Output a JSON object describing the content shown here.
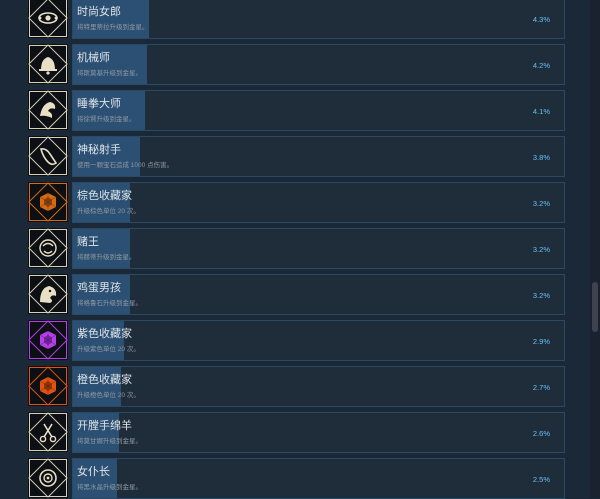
{
  "achievements": [
    {
      "title": "时尚女郎",
      "desc": "将特里蒂拉升级到金星。",
      "pct": "4.3%",
      "percent": 4.3,
      "icon": "eye-emblem-icon",
      "gem": "#d8cfb6"
    },
    {
      "title": "机械师",
      "desc": "将斯莫基升级到金星。",
      "pct": "4.2%",
      "percent": 4.2,
      "icon": "bell-icon",
      "gem": "#d8cfb6"
    },
    {
      "title": "睡拳大师",
      "desc": "将徐賢升级到金星。",
      "pct": "4.1%",
      "percent": 4.1,
      "icon": "dragon-icon",
      "gem": "#d8cfb6"
    },
    {
      "title": "神秘射手",
      "desc": "使用一颗宝石造成 1000 点伤害。",
      "pct": "3.8%",
      "percent": 3.8,
      "icon": "hand-icon",
      "gem": "#d8cfb6"
    },
    {
      "title": "棕色收藏家",
      "desc": "升级棕色单位 20 次。",
      "pct": "3.2%",
      "percent": 3.2,
      "icon": "brown-gem-icon",
      "gem": "#d96a12"
    },
    {
      "title": "赌王",
      "desc": "将赫蒂升级到金星。",
      "pct": "3.2%",
      "percent": 3.2,
      "icon": "gambler-icon",
      "gem": "#d8cfb6"
    },
    {
      "title": "鸡蛋男孩",
      "desc": "将格鲁石升级到金星。",
      "pct": "3.2%",
      "percent": 3.2,
      "icon": "beast-icon",
      "gem": "#d8cfb6"
    },
    {
      "title": "紫色收藏家",
      "desc": "升级紫色单位 20 次。",
      "pct": "2.9%",
      "percent": 2.9,
      "icon": "purple-gem-icon",
      "gem": "#b83cf0"
    },
    {
      "title": "橙色收藏家",
      "desc": "升级橙色单位 20 次。",
      "pct": "2.7%",
      "percent": 2.7,
      "icon": "orange-gem-icon",
      "gem": "#e4520e"
    },
    {
      "title": "开膛手绵羊",
      "desc": "将莫甘娜升级到金星。",
      "pct": "2.6%",
      "percent": 2.6,
      "icon": "scissors-icon",
      "gem": "#d8cfb6"
    },
    {
      "title": "女仆长",
      "desc": "将黑水晶升级到金星。",
      "pct": "2.5%",
      "percent": 2.5,
      "icon": "medallion-icon",
      "gem": "#d8cfb6"
    }
  ]
}
